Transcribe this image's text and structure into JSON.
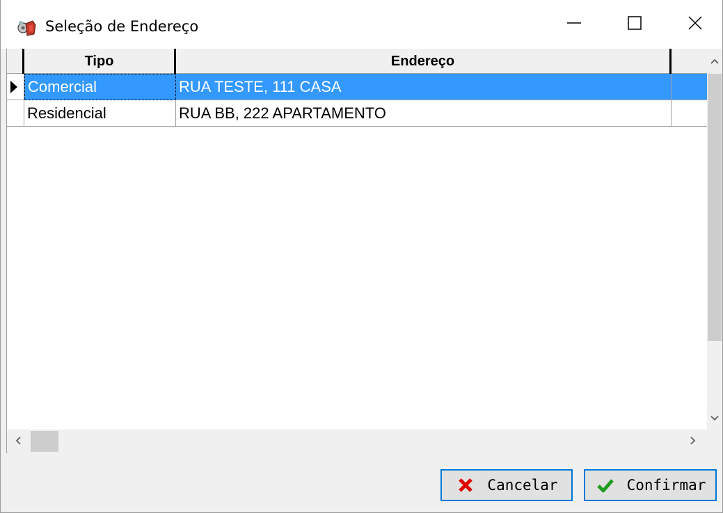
{
  "window": {
    "title": "Seleção de Endereço",
    "icon": "app-icon",
    "controls": {
      "minimize": "minimize-icon",
      "maximize": "maximize-icon",
      "close": "close-icon"
    }
  },
  "grid": {
    "columns": [
      "Tipo",
      "Endereço"
    ],
    "rows": [
      {
        "tipo": "Comercial",
        "endereco": "RUA TESTE, 111 CASA",
        "selected": true
      },
      {
        "tipo": "Residencial",
        "endereco": "RUA BB, 222 APARTAMENTO",
        "selected": false
      }
    ],
    "selection_color": "#3399ff"
  },
  "buttons": {
    "cancel_label": "Cancelar",
    "cancel_icon": "x-icon",
    "cancel_icon_color": "#e00000",
    "confirm_label": "Confirmar",
    "confirm_icon": "checkmark-icon",
    "confirm_icon_color": "#1f9e1f",
    "border_color": "#0078d7"
  }
}
